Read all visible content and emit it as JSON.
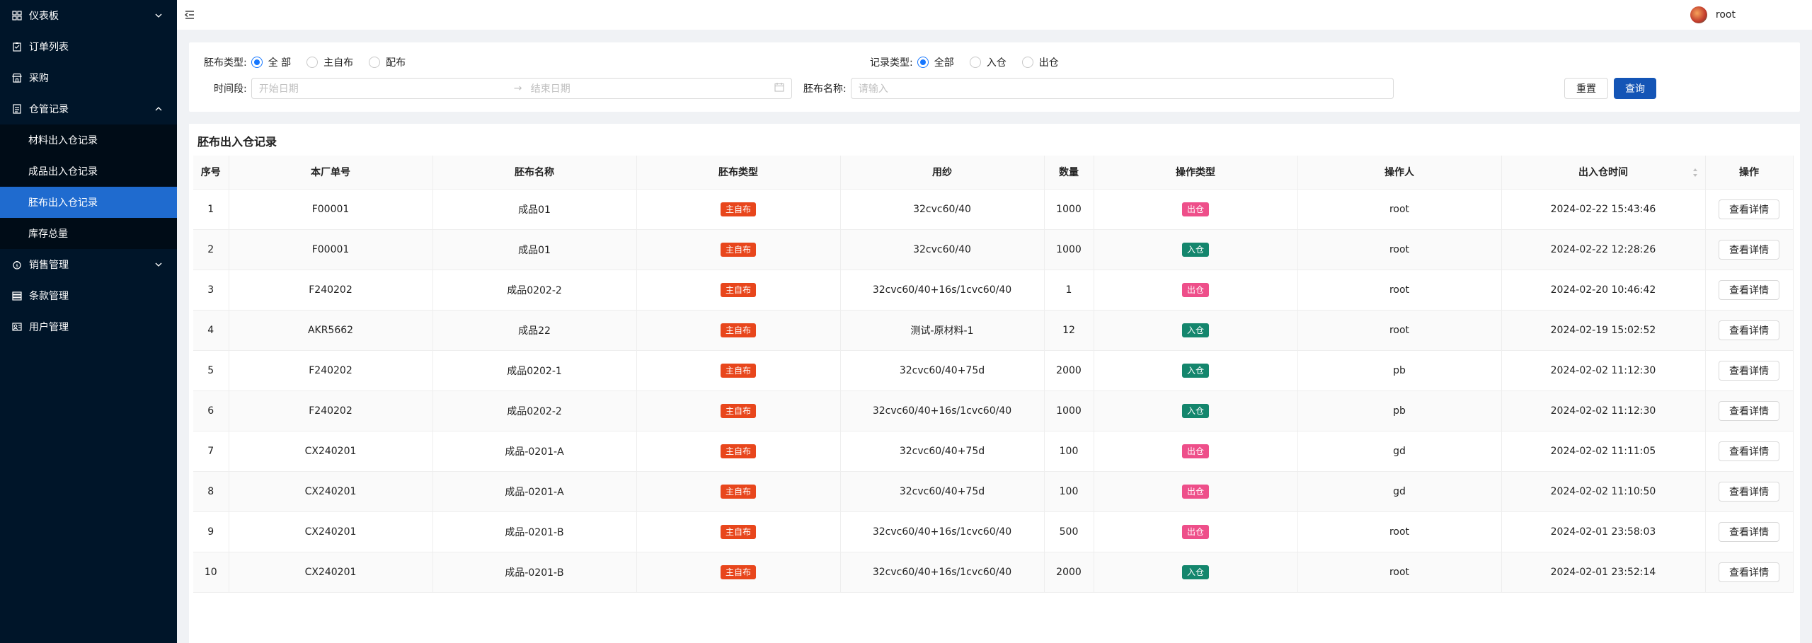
{
  "sidebar": {
    "items": [
      {
        "label": "仪表板",
        "icon": "dashboard-icon"
      },
      {
        "label": "订单列表",
        "icon": "clipboard-icon"
      },
      {
        "label": "采购",
        "icon": "shop-icon"
      },
      {
        "label": "仓管记录",
        "icon": "document-icon"
      },
      {
        "label": "销售管理",
        "icon": "money-bag-icon"
      },
      {
        "label": "条款管理",
        "icon": "database-icon"
      },
      {
        "label": "用户管理",
        "icon": "user-card-icon"
      }
    ],
    "submenu": [
      {
        "label": "材料出入仓记录"
      },
      {
        "label": "成品出入仓记录"
      },
      {
        "label": "胚布出入仓记录"
      },
      {
        "label": "库存总量"
      }
    ]
  },
  "header": {
    "username": "root"
  },
  "filters": {
    "fabric_type_label": "胚布类型:",
    "fabric_type_options": [
      "全 部",
      "主自布",
      "配布"
    ],
    "record_type_label": "记录类型:",
    "record_type_options": [
      "全部",
      "入仓",
      "出仓"
    ],
    "period_label": "时间段:",
    "start_placeholder": "开始日期",
    "end_placeholder": "结束日期",
    "name_label": "胚布名称:",
    "name_placeholder": "请输入",
    "reset_label": "重置",
    "query_label": "查询"
  },
  "table": {
    "title": "胚布出入仓记录",
    "columns": [
      "序号",
      "本厂单号",
      "胚布名称",
      "胚布类型",
      "用纱",
      "数量",
      "操作类型",
      "操作人",
      "出入仓时间",
      "操作"
    ],
    "action_label": "查看详情",
    "rows": [
      {
        "no": "1",
        "order": "F00001",
        "name": "成品01",
        "type": "主自布",
        "yarn": "32cvc60/40",
        "qty": "1000",
        "op": "出仓",
        "user": "root",
        "time": "2024-02-22 15:43:46"
      },
      {
        "no": "2",
        "order": "F00001",
        "name": "成品01",
        "type": "主自布",
        "yarn": "32cvc60/40",
        "qty": "1000",
        "op": "入仓",
        "user": "root",
        "time": "2024-02-22 12:28:26"
      },
      {
        "no": "3",
        "order": "F240202",
        "name": "成品0202-2",
        "type": "主自布",
        "yarn": "32cvc60/40+16s/1cvc60/40",
        "qty": "1",
        "op": "出仓",
        "user": "root",
        "time": "2024-02-20 10:46:42"
      },
      {
        "no": "4",
        "order": "AKR5662",
        "name": "成品22",
        "type": "主自布",
        "yarn": "测试-原材料-1",
        "qty": "12",
        "op": "入仓",
        "user": "root",
        "time": "2024-02-19 15:02:52"
      },
      {
        "no": "5",
        "order": "F240202",
        "name": "成品0202-1",
        "type": "主自布",
        "yarn": "32cvc60/40+75d",
        "qty": "2000",
        "op": "入仓",
        "user": "pb",
        "time": "2024-02-02 11:12:30"
      },
      {
        "no": "6",
        "order": "F240202",
        "name": "成品0202-2",
        "type": "主自布",
        "yarn": "32cvc60/40+16s/1cvc60/40",
        "qty": "1000",
        "op": "入仓",
        "user": "pb",
        "time": "2024-02-02 11:12:30"
      },
      {
        "no": "7",
        "order": "CX240201",
        "name": "成品-0201-A",
        "type": "主自布",
        "yarn": "32cvc60/40+75d",
        "qty": "100",
        "op": "出仓",
        "user": "gd",
        "time": "2024-02-02 11:11:05"
      },
      {
        "no": "8",
        "order": "CX240201",
        "name": "成品-0201-A",
        "type": "主自布",
        "yarn": "32cvc60/40+75d",
        "qty": "100",
        "op": "出仓",
        "user": "gd",
        "time": "2024-02-02 11:10:50"
      },
      {
        "no": "9",
        "order": "CX240201",
        "name": "成品-0201-B",
        "type": "主自布",
        "yarn": "32cvc60/40+16s/1cvc60/40",
        "qty": "500",
        "op": "出仓",
        "user": "root",
        "time": "2024-02-01 23:58:03"
      },
      {
        "no": "10",
        "order": "CX240201",
        "name": "成品-0201-B",
        "type": "主自布",
        "yarn": "32cvc60/40+16s/1cvc60/40",
        "qty": "2000",
        "op": "入仓",
        "user": "root",
        "time": "2024-02-01 23:52:14"
      }
    ]
  },
  "colors": {
    "sidebar_bg": "#001529",
    "active_item": "#1f6bcf",
    "primary": "#1455b6",
    "tag_type": "#e8461c",
    "tag_out": "#ee4f8a",
    "tag_in": "#14866d"
  }
}
